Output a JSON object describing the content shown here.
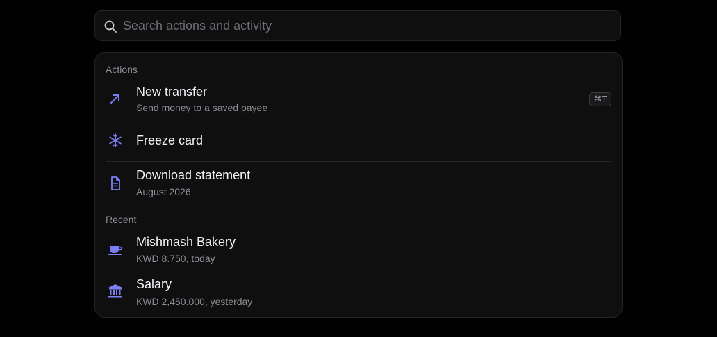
{
  "search": {
    "placeholder": "Search actions and activity",
    "value": ""
  },
  "sections": {
    "actions_label": "Actions",
    "recent_label": "Recent"
  },
  "actions": [
    {
      "title": "New transfer",
      "subtitle": "Send money to a saved payee",
      "icon": "arrow-up-right-icon",
      "shortcut": "⌘T"
    },
    {
      "title": "Freeze card",
      "subtitle": "",
      "icon": "snowflake-icon"
    },
    {
      "title": "Download statement",
      "subtitle": "August 2026",
      "icon": "document-icon"
    }
  ],
  "recent": [
    {
      "title": "Mishmash Bakery",
      "subtitle": "KWD 8.750, today",
      "icon": "coffee-cup-icon"
    },
    {
      "title": "Salary",
      "subtitle": "KWD 2,450.000, yesterday",
      "icon": "bank-icon"
    }
  ],
  "colors": {
    "accent": "#7b7ff5",
    "background": "#000000",
    "panel": "#0f0f10",
    "text_primary": "#f2f2f4",
    "text_secondary": "#8e8e93"
  }
}
